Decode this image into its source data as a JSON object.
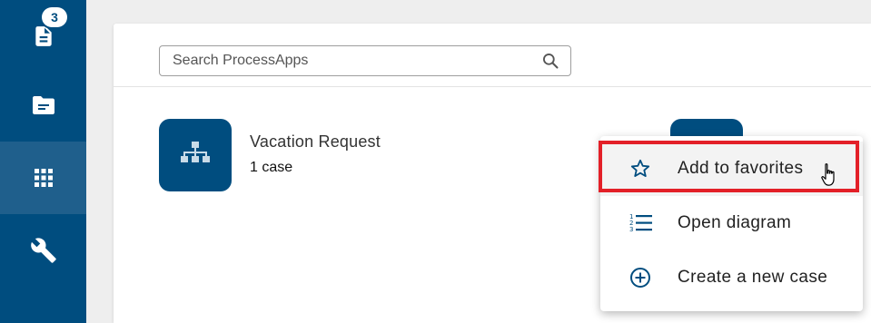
{
  "sidebar": {
    "items": [
      {
        "name": "tasks",
        "icon": "task-list-icon",
        "badge": "3"
      },
      {
        "name": "cases",
        "icon": "folder-icon"
      },
      {
        "name": "process-apps",
        "icon": "apps-grid-icon",
        "active": true
      },
      {
        "name": "admin",
        "icon": "wrench-icon"
      }
    ]
  },
  "search": {
    "placeholder": "Search ProcessApps",
    "value": ""
  },
  "app_card": {
    "title": "Vacation Request",
    "count": "1 case",
    "icon": "org-chart-icon"
  },
  "context_menu": {
    "items": [
      {
        "label": "Add to favorites",
        "icon": "star-outline-icon",
        "highlighted": true
      },
      {
        "label": "Open diagram",
        "icon": "numbered-list-icon"
      },
      {
        "label": "Create a new case",
        "icon": "add-circle-icon"
      }
    ]
  },
  "colors": {
    "brand": "#004d7f",
    "highlight_border": "#e32028",
    "background": "#eeeeee"
  }
}
